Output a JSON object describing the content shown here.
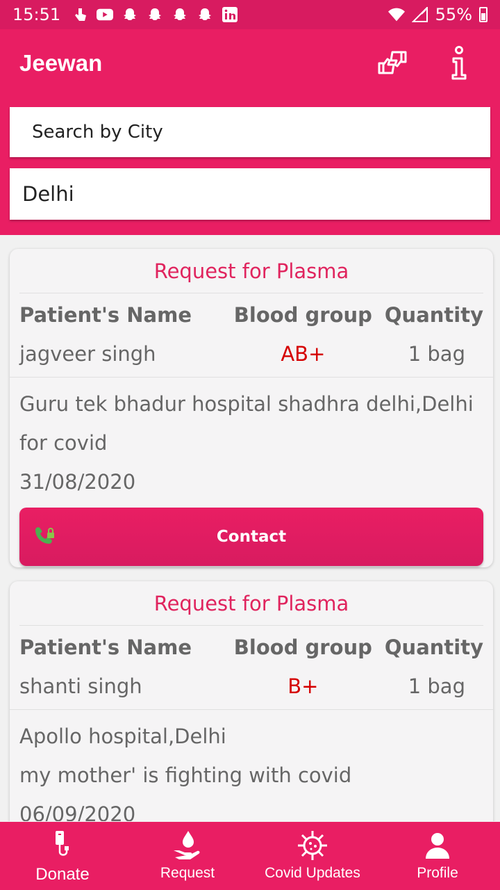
{
  "status_bar": {
    "time": "15:51",
    "battery": "55%"
  },
  "app_bar": {
    "title": "Jeewan"
  },
  "search": {
    "placeholder": "Search by City",
    "city_value": "Delhi"
  },
  "cards": [
    {
      "header": "Request for Plasma",
      "col_headers": [
        "Patient's Name",
        "Blood group",
        "Quantity"
      ],
      "patient": "jagveer singh",
      "blood_group": "AB+",
      "quantity": "1 bag",
      "location": "Guru tek bhadur hospital shadhra delhi,Delhi",
      "note": "for covid",
      "date": "31/08/2020",
      "contact_label": "Contact"
    },
    {
      "header": "Request for Plasma",
      "col_headers": [
        "Patient's Name",
        "Blood group",
        "Quantity"
      ],
      "patient": "shanti singh",
      "blood_group": "B+",
      "quantity": "1 bag",
      "location": "Apollo hospital,Delhi",
      "note": "my mother' is fighting with covid",
      "date": "06/09/2020"
    }
  ],
  "bottom_nav": [
    {
      "label": "Donate",
      "icon": "iv-drip-icon",
      "active": true
    },
    {
      "label": "Request",
      "icon": "blood-drop-hand-icon",
      "active": false
    },
    {
      "label": "Covid Updates",
      "icon": "virus-icon",
      "active": false
    },
    {
      "label": "Profile",
      "icon": "person-icon",
      "active": false
    }
  ],
  "colors": {
    "primary": "#e91e63",
    "status_bar": "#d81b60",
    "accent_text": "#e0245e",
    "blood_group": "#d50000"
  }
}
